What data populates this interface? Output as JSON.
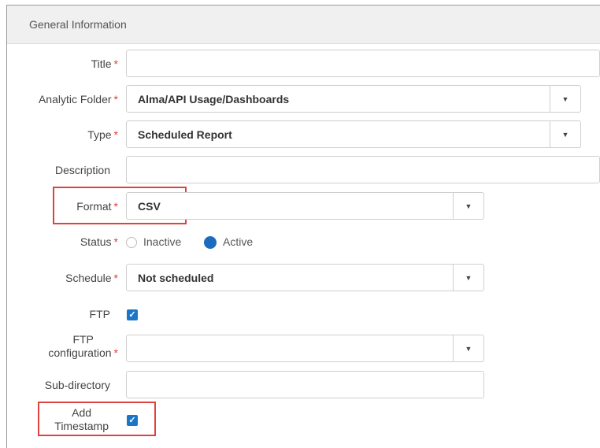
{
  "section": {
    "title": "General Information"
  },
  "fields": {
    "title": {
      "label": "Title",
      "required_mark": "*",
      "value": ""
    },
    "analytic_folder": {
      "label": "Analytic Folder",
      "required_mark": "*",
      "value": "Alma/API Usage/Dashboards"
    },
    "type": {
      "label": "Type",
      "required_mark": "*",
      "value": "Scheduled Report"
    },
    "description": {
      "label": "Description",
      "value": ""
    },
    "format": {
      "label": "Format",
      "required_mark": "*",
      "value": "CSV"
    },
    "status": {
      "label": "Status",
      "required_mark": "*",
      "options": [
        "Inactive",
        "Active"
      ],
      "selected": "Active"
    },
    "schedule": {
      "label": "Schedule",
      "required_mark": "*",
      "value": "Not scheduled"
    },
    "ftp": {
      "label": "FTP",
      "checked": true
    },
    "ftp_configuration": {
      "label_line1": "FTP",
      "label_line2": "configuration",
      "required_mark": "*",
      "value": ""
    },
    "sub_directory": {
      "label": "Sub-directory",
      "value": ""
    },
    "add_timestamp": {
      "label_line1": "Add",
      "label_line2": "Timestamp",
      "checked": true
    }
  },
  "icons": {
    "dropdown": "caret-down-icon",
    "check": "checkmark-icon"
  },
  "colors": {
    "required": "#e53935",
    "accent": "#1b76c8",
    "highlight": "#e0433f"
  }
}
